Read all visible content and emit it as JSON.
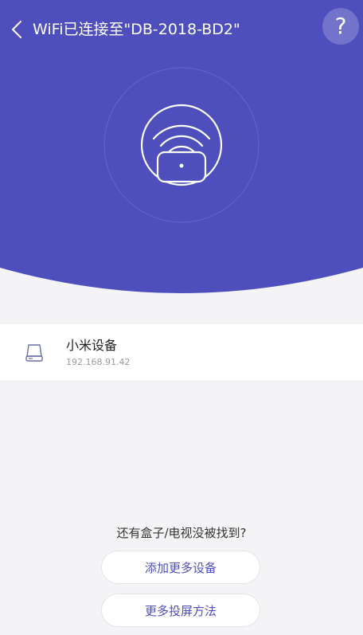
{
  "header": {
    "title": "WiFi已连接至\"DB-2018-BD2\"",
    "help_label": "?"
  },
  "devices": [
    {
      "name": "小米设备",
      "ip": "192.168.91.42"
    }
  ],
  "footer": {
    "not_found_text": "还有盒子/电视没被找到?",
    "add_more_label": "添加更多设备",
    "more_methods_label": "更多投屏方法"
  },
  "colors": {
    "primary": "#4e4fbc",
    "background": "#f4f4f6"
  }
}
